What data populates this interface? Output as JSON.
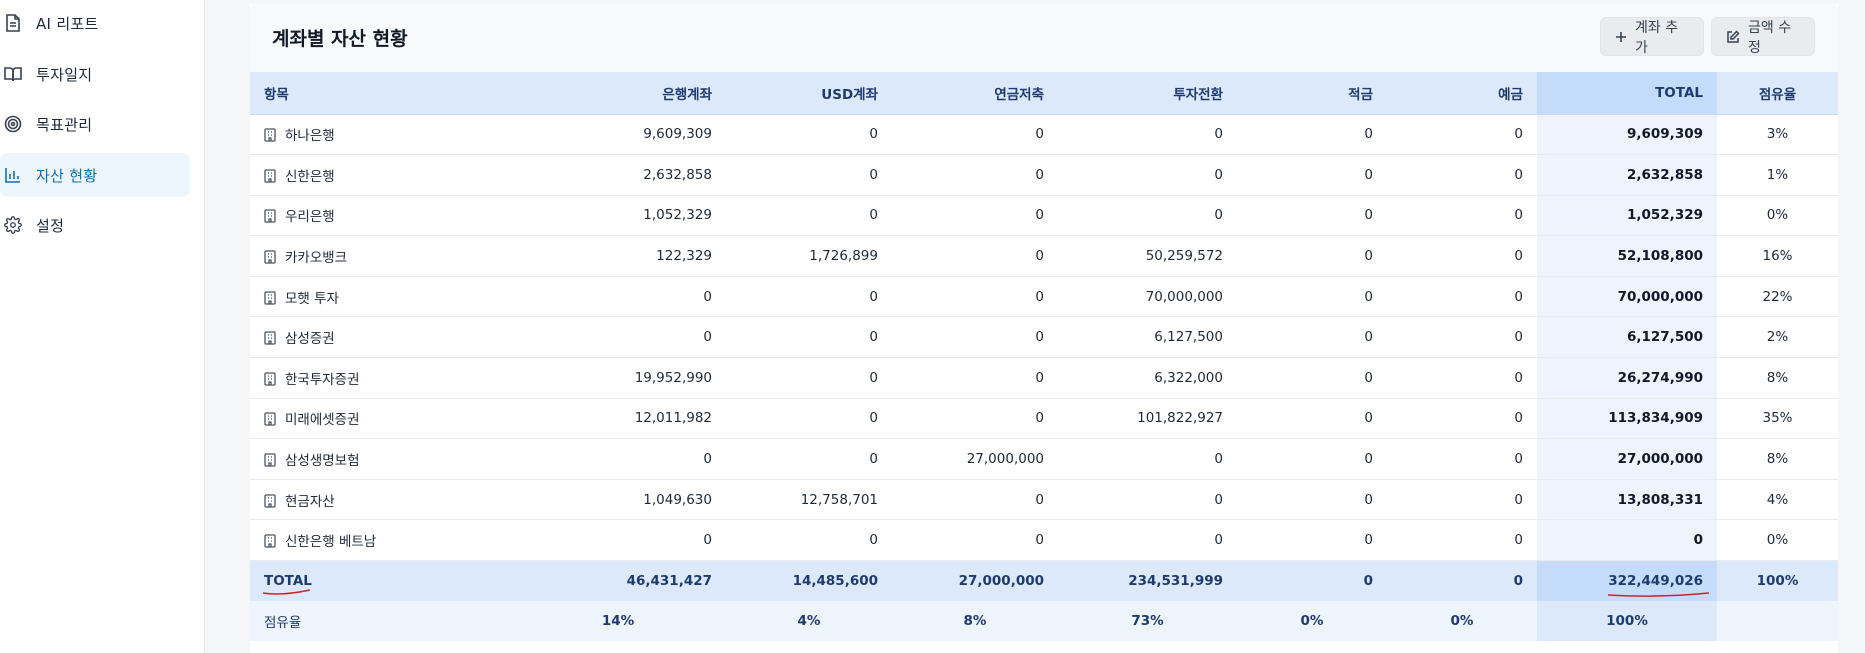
{
  "sidebar": {
    "items": [
      {
        "label": "AI 리포트",
        "icon": "document-icon",
        "active": false
      },
      {
        "label": "투자일지",
        "icon": "book-icon",
        "active": false
      },
      {
        "label": "목표관리",
        "icon": "target-icon",
        "active": false
      },
      {
        "label": "자산 현황",
        "icon": "bar-chart-icon",
        "active": true
      },
      {
        "label": "설정",
        "icon": "gear-icon",
        "active": false
      }
    ]
  },
  "main": {
    "title": "계좌별 자산 현황",
    "add_button": "계좌 추가",
    "edit_button": "금액 수정"
  },
  "table": {
    "headers": [
      "항목",
      "은행계좌",
      "USD계좌",
      "연금저축",
      "투자전환",
      "적금",
      "예금",
      "TOTAL",
      "점유율"
    ],
    "rows": [
      {
        "name": "하나은행",
        "bank": "9,609,309",
        "usd": "0",
        "pension": "0",
        "invest": "0",
        "saving": "0",
        "deposit": "0",
        "total": "9,609,309",
        "share": "3%"
      },
      {
        "name": "신한은행",
        "bank": "2,632,858",
        "usd": "0",
        "pension": "0",
        "invest": "0",
        "saving": "0",
        "deposit": "0",
        "total": "2,632,858",
        "share": "1%"
      },
      {
        "name": "우리은행",
        "bank": "1,052,329",
        "usd": "0",
        "pension": "0",
        "invest": "0",
        "saving": "0",
        "deposit": "0",
        "total": "1,052,329",
        "share": "0%"
      },
      {
        "name": "카카오뱅크",
        "bank": "122,329",
        "usd": "1,726,899",
        "pension": "0",
        "invest": "50,259,572",
        "saving": "0",
        "deposit": "0",
        "total": "52,108,800",
        "share": "16%"
      },
      {
        "name": "모햇 투자",
        "bank": "0",
        "usd": "0",
        "pension": "0",
        "invest": "70,000,000",
        "saving": "0",
        "deposit": "0",
        "total": "70,000,000",
        "share": "22%"
      },
      {
        "name": "삼성증권",
        "bank": "0",
        "usd": "0",
        "pension": "0",
        "invest": "6,127,500",
        "saving": "0",
        "deposit": "0",
        "total": "6,127,500",
        "share": "2%"
      },
      {
        "name": "한국투자증권",
        "bank": "19,952,990",
        "usd": "0",
        "pension": "0",
        "invest": "6,322,000",
        "saving": "0",
        "deposit": "0",
        "total": "26,274,990",
        "share": "8%"
      },
      {
        "name": "미래에셋증권",
        "bank": "12,011,982",
        "usd": "0",
        "pension": "0",
        "invest": "101,822,927",
        "saving": "0",
        "deposit": "0",
        "total": "113,834,909",
        "share": "35%"
      },
      {
        "name": "삼성생명보험",
        "bank": "0",
        "usd": "0",
        "pension": "27,000,000",
        "invest": "0",
        "saving": "0",
        "deposit": "0",
        "total": "27,000,000",
        "share": "8%"
      },
      {
        "name": "현금자산",
        "bank": "1,049,630",
        "usd": "12,758,701",
        "pension": "0",
        "invest": "0",
        "saving": "0",
        "deposit": "0",
        "total": "13,808,331",
        "share": "4%"
      },
      {
        "name": "신한은행 베트남",
        "bank": "0",
        "usd": "0",
        "pension": "0",
        "invest": "0",
        "saving": "0",
        "deposit": "0",
        "total": "0",
        "share": "0%"
      }
    ],
    "total_row": {
      "name": "TOTAL",
      "bank": "46,431,427",
      "usd": "14,485,600",
      "pension": "27,000,000",
      "invest": "234,531,999",
      "saving": "0",
      "deposit": "0",
      "total": "322,449,026",
      "share": "100%"
    },
    "share_row": {
      "name": "점유율",
      "bank": "14%",
      "usd": "4%",
      "pension": "8%",
      "invest": "73%",
      "saving": "0%",
      "deposit": "0%",
      "total": "100%"
    }
  },
  "colors": {
    "accent": "#0b6fb3",
    "header_bg": "#dbe9fb",
    "annotation_red": "#d0212b"
  }
}
